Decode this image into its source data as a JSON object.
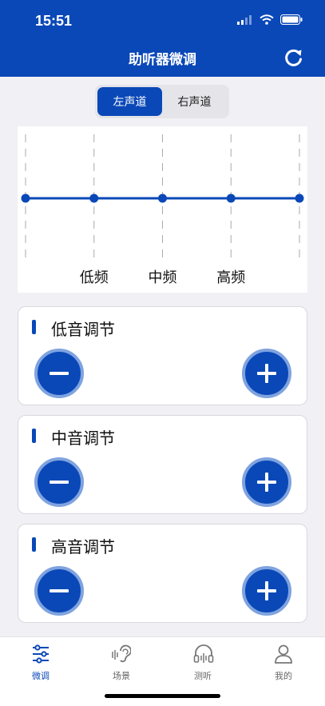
{
  "status_bar": {
    "time": "15:51"
  },
  "nav": {
    "title": "助听器微调",
    "refresh_icon": "refresh-icon"
  },
  "segment": {
    "left": "左声道",
    "right": "右声道",
    "selected": "左声道"
  },
  "chart_data": {
    "type": "line",
    "categories": [
      "",
      "低频",
      "中频",
      "高频",
      ""
    ],
    "values": [
      0,
      0,
      0,
      0,
      0
    ],
    "grid": "dashed-vertical"
  },
  "cards": [
    {
      "title": "低音调节",
      "minus_icon": "minus-icon",
      "plus_icon": "plus-icon"
    },
    {
      "title": "中音调节",
      "minus_icon": "minus-icon",
      "plus_icon": "plus-icon"
    },
    {
      "title": "高音调节",
      "minus_icon": "minus-icon",
      "plus_icon": "plus-icon"
    }
  ],
  "tabbar": {
    "items": [
      {
        "label": "微调",
        "icon": "sliders-icon",
        "active": true
      },
      {
        "label": "场景",
        "icon": "ear-icon",
        "active": false
      },
      {
        "label": "测听",
        "icon": "headphones-icon",
        "active": false
      },
      {
        "label": "我的",
        "icon": "person-icon",
        "active": false
      }
    ]
  },
  "colors": {
    "primary": "#0A48B8",
    "button_ring": "#7FA3DF",
    "background": "#F0F0F5"
  }
}
